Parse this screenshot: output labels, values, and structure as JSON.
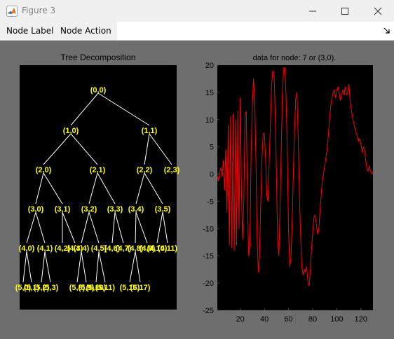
{
  "window": {
    "title": "Figure 3",
    "app_icon": "matlab-logo",
    "controls": [
      "minimize-icon",
      "maximize-icon",
      "close-icon"
    ]
  },
  "menu": {
    "items": [
      "Node Label",
      "Node Action"
    ],
    "undock_icon": "undock-arrow-icon"
  },
  "colors": {
    "figure_bg": "#6e6e6e",
    "axes_bg": "#000000",
    "tree_label": "#ffff00",
    "tree_edge": "#ffffff",
    "signal": "#ff0000"
  },
  "tree": {
    "title": "Tree Decomposition",
    "nodes": [
      {
        "id": "n00",
        "label": "(0,0)"
      },
      {
        "id": "n10",
        "label": "(1,0)"
      },
      {
        "id": "n11",
        "label": "(1,1)"
      },
      {
        "id": "n20",
        "label": "(2,0)"
      },
      {
        "id": "n21",
        "label": "(2,1)"
      },
      {
        "id": "n22",
        "label": "(2,2)"
      },
      {
        "id": "n23",
        "label": "(2,3)"
      },
      {
        "id": "n30",
        "label": "(3,0)"
      },
      {
        "id": "n31",
        "label": "(3,1)"
      },
      {
        "id": "n32",
        "label": "(3,2)"
      },
      {
        "id": "n33",
        "label": "(3,3)"
      },
      {
        "id": "n34",
        "label": "(3,4)"
      },
      {
        "id": "n35",
        "label": "(3,5)"
      },
      {
        "id": "n40",
        "label": "(4,0)"
      },
      {
        "id": "n41",
        "label": "(4,1)"
      },
      {
        "id": "n42",
        "label": "(4,2)"
      },
      {
        "id": "n43",
        "label": "(4,3)"
      },
      {
        "id": "n44",
        "label": "(4,4)"
      },
      {
        "id": "n45",
        "label": "(4,5)"
      },
      {
        "id": "n46",
        "label": "(4,6)"
      },
      {
        "id": "n47",
        "label": "(4,7)"
      },
      {
        "id": "n48",
        "label": "(4,8)"
      },
      {
        "id": "n49",
        "label": "(4,9)"
      },
      {
        "id": "n410",
        "label": "(4,10)"
      },
      {
        "id": "n411",
        "label": "(4,11)"
      },
      {
        "id": "n50",
        "label": "(5,0)"
      },
      {
        "id": "n51",
        "label": "(5,1)"
      },
      {
        "id": "n52",
        "label": "(5,2)"
      },
      {
        "id": "n53",
        "label": "(5,3)"
      },
      {
        "id": "n58",
        "label": "(5,8)"
      },
      {
        "id": "n59",
        "label": "(5,9)"
      },
      {
        "id": "n510",
        "label": "(5,10)"
      },
      {
        "id": "n511",
        "label": "(5,11)"
      },
      {
        "id": "n516",
        "label": "(5,16)"
      },
      {
        "id": "n517",
        "label": "(5,17)"
      }
    ],
    "edges": [
      [
        "n00",
        "n10"
      ],
      [
        "n00",
        "n11"
      ],
      [
        "n10",
        "n20"
      ],
      [
        "n10",
        "n21"
      ],
      [
        "n11",
        "n22"
      ],
      [
        "n11",
        "n23"
      ],
      [
        "n20",
        "n30"
      ],
      [
        "n20",
        "n31"
      ],
      [
        "n21",
        "n32"
      ],
      [
        "n21",
        "n33"
      ],
      [
        "n22",
        "n34"
      ],
      [
        "n22",
        "n35"
      ],
      [
        "n30",
        "n40"
      ],
      [
        "n30",
        "n41"
      ],
      [
        "n31",
        "n42"
      ],
      [
        "n31",
        "n43"
      ],
      [
        "n32",
        "n44"
      ],
      [
        "n32",
        "n45"
      ],
      [
        "n33",
        "n46"
      ],
      [
        "n33",
        "n47"
      ],
      [
        "n34",
        "n48"
      ],
      [
        "n34",
        "n49"
      ],
      [
        "n35",
        "n410"
      ],
      [
        "n35",
        "n411"
      ],
      [
        "n40",
        "n50"
      ],
      [
        "n40",
        "n51"
      ],
      [
        "n41",
        "n52"
      ],
      [
        "n41",
        "n53"
      ],
      [
        "n44",
        "n58"
      ],
      [
        "n44",
        "n59"
      ],
      [
        "n45",
        "n510"
      ],
      [
        "n45",
        "n511"
      ],
      [
        "n48",
        "n516"
      ],
      [
        "n48",
        "n517"
      ]
    ]
  },
  "chart_data": {
    "type": "line",
    "title": "data for node: 7 or (3,0).",
    "xlim": [
      1,
      130
    ],
    "ylim": [
      -25,
      20
    ],
    "xticks": [
      20,
      40,
      60,
      80,
      100,
      120
    ],
    "yticks": [
      -25,
      -20,
      -15,
      -10,
      -5,
      0,
      5,
      10,
      15,
      20
    ],
    "grid": false,
    "series": [
      {
        "color": "#ff0000",
        "x": [
          1,
          2,
          3,
          4,
          5,
          6,
          7,
          8,
          9,
          10,
          11,
          12,
          13,
          14,
          15,
          16,
          17,
          18,
          19,
          20,
          21,
          22,
          23,
          24,
          25,
          26,
          27,
          28,
          29,
          30,
          31,
          32,
          33,
          34,
          35,
          36,
          37,
          38,
          39,
          40,
          41,
          42,
          43,
          44,
          45,
          46,
          47,
          48,
          49,
          50,
          51,
          52,
          53,
          54,
          55,
          56,
          57,
          58,
          59,
          60,
          61,
          62,
          63,
          64,
          65,
          66,
          67,
          68,
          69,
          70,
          71,
          72,
          73,
          74,
          75,
          76,
          77,
          78,
          79,
          80,
          81,
          82,
          83,
          84,
          85,
          86,
          87,
          88,
          89,
          90,
          91,
          92,
          93,
          94,
          95,
          96,
          97,
          98,
          99,
          100,
          101,
          102,
          103,
          104,
          105,
          106,
          107,
          108,
          109,
          110,
          111,
          112,
          113,
          114,
          115,
          116,
          117,
          118,
          119,
          120,
          121,
          122,
          123,
          124,
          125,
          126,
          127,
          128,
          129,
          130
        ],
        "y": [
          -0.5,
          -1.3,
          0.3,
          1.2,
          -0.5,
          2.5,
          -3,
          4.5,
          -7,
          9,
          -13,
          10.5,
          -13.5,
          11,
          -14,
          10,
          -13,
          11.5,
          -10,
          14,
          -3,
          -12,
          -4,
          11,
          11.5,
          -5,
          -15,
          -13,
          4,
          12.5,
          17.5,
          14,
          2,
          -12,
          -18,
          -15,
          -5,
          3,
          7.5,
          7.5,
          3,
          -4,
          -5,
          2.5,
          9,
          16.5,
          19,
          18.5,
          11,
          0,
          -12,
          -15,
          -6,
          5,
          15,
          19.5,
          19.5,
          14,
          4,
          -10,
          -17,
          -15.5,
          -9,
          0,
          8,
          14,
          15,
          7,
          -3,
          -11,
          -17,
          -18.5,
          -17.5,
          -18,
          -17,
          -19.5,
          -20.5,
          -18,
          -14,
          -11,
          -8,
          -7.5,
          -9,
          -11,
          -10.5,
          -7,
          -4,
          -1.5,
          0,
          1.5,
          3,
          4.5,
          7,
          10,
          12.5,
          14,
          15,
          15.5,
          14,
          15.5,
          16,
          15,
          13.5,
          14.5,
          15.5,
          14.5,
          16,
          14.5,
          15,
          16.5,
          13.5,
          12,
          10.5,
          9.5,
          8.5,
          7.5,
          7,
          6,
          6.5,
          5.5,
          4,
          5,
          4.5,
          2.5,
          1,
          0.5,
          1.5,
          0.5,
          0,
          0.5
        ]
      }
    ]
  }
}
